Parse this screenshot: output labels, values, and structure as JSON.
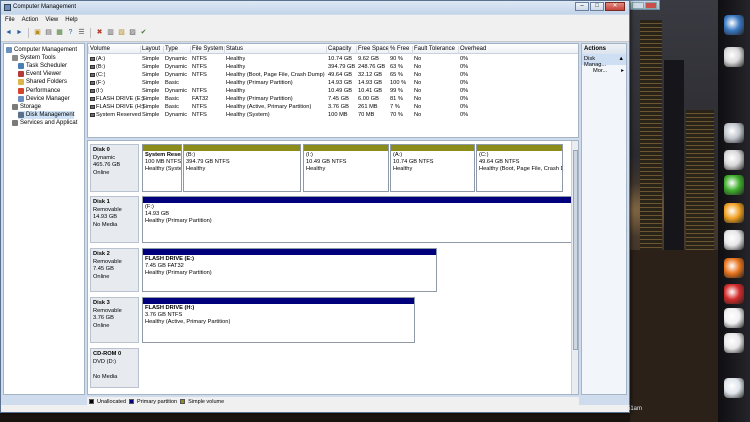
{
  "window": {
    "title": "Computer Management",
    "bg_window_title": ""
  },
  "menu": [
    "File",
    "Action",
    "View",
    "Help"
  ],
  "tree": [
    {
      "label": "Computer Management",
      "indent": 0,
      "icon": "computer-icon",
      "color": "#6b8fbf"
    },
    {
      "label": "System Tools",
      "indent": 1,
      "icon": "tools-icon",
      "color": "#8a8a8a"
    },
    {
      "label": "Task Scheduler",
      "indent": 2,
      "icon": "clock-icon",
      "color": "#4a7fb5"
    },
    {
      "label": "Event Viewer",
      "indent": 2,
      "icon": "event-icon",
      "color": "#b53a3a"
    },
    {
      "label": "Shared Folders",
      "indent": 2,
      "icon": "folder-icon",
      "color": "#d9b54a"
    },
    {
      "label": "Performance",
      "indent": 2,
      "icon": "performance-icon",
      "color": "#d4452d"
    },
    {
      "label": "Device Manager",
      "indent": 2,
      "icon": "device-icon",
      "color": "#6b8fbf"
    },
    {
      "label": "Storage",
      "indent": 1,
      "icon": "storage-icon",
      "color": "#7a7a7a"
    },
    {
      "label": "Disk Management",
      "indent": 2,
      "icon": "disk-icon",
      "color": "#5a6f8a"
    },
    {
      "label": "Services and Applicat",
      "indent": 1,
      "icon": "services-icon",
      "color": "#7a7a7a"
    }
  ],
  "volume_columns": [
    "Volume",
    "Layout",
    "Type",
    "File System",
    "Status",
    "Capacity",
    "Free Space",
    "% Free",
    "Fault Tolerance",
    "Overhead"
  ],
  "volumes": [
    [
      "(A:)",
      "Simple",
      "Dynamic",
      "NTFS",
      "Healthy",
      "10.74 GB",
      "9.62 GB",
      "90 %",
      "No",
      "0%"
    ],
    [
      "(B:)",
      "Simple",
      "Dynamic",
      "NTFS",
      "Healthy",
      "394.79 GB",
      "248.76 GB",
      "63 %",
      "No",
      "0%"
    ],
    [
      "(C:)",
      "Simple",
      "Dynamic",
      "NTFS",
      "Healthy (Boot, Page File, Crash Dump)",
      "49.64 GB",
      "32.12 GB",
      "65 %",
      "No",
      "0%"
    ],
    [
      "(F:)",
      "Simple",
      "Basic",
      "",
      "Healthy (Primary Partition)",
      "14.93 GB",
      "14.93 GB",
      "100 %",
      "No",
      "0%"
    ],
    [
      "(I:)",
      "Simple",
      "Dynamic",
      "NTFS",
      "Healthy",
      "10.49 GB",
      "10.41 GB",
      "99 %",
      "No",
      "0%"
    ],
    [
      "FLASH DRIVE (E:)",
      "Simple",
      "Basic",
      "FAT32",
      "Healthy (Primary Partition)",
      "7.45 GB",
      "6.00 GB",
      "81 %",
      "No",
      "0%"
    ],
    [
      "FLASH DRIVE (H:)",
      "Simple",
      "Basic",
      "NTFS",
      "Healthy (Active, Primary Partition)",
      "3.76 GB",
      "261 MB",
      "7 %",
      "No",
      "0%"
    ],
    [
      "System Reserved",
      "Simple",
      "Dynamic",
      "NTFS",
      "Healthy (System)",
      "100 MB",
      "70 MB",
      "70 %",
      "No",
      "0%"
    ]
  ],
  "disks": [
    {
      "name": "Disk 0",
      "type": "Dynamic",
      "size": "465.76 GB",
      "state": "Online",
      "partitions": [
        {
          "title": "System Reser",
          "size": "100 MB NTFS",
          "status": "Healthy (Syste",
          "bar": "olive",
          "bold": true
        },
        {
          "title": "(B:)",
          "size": "394.79 GB NTFS",
          "status": "Healthy",
          "bar": "olive",
          "bold": false
        },
        {
          "title": "(I:)",
          "size": "10.49 GB NTFS",
          "status": "Healthy",
          "bar": "olive",
          "bold": false
        },
        {
          "title": "(A:)",
          "size": "10.74 GB NTFS",
          "status": "Healthy",
          "bar": "olive",
          "bold": false
        },
        {
          "title": "(C:)",
          "size": "49.64 GB NTFS",
          "status": "Healthy (Boot, Page File, Crash Dump",
          "bar": "olive",
          "bold": false
        }
      ]
    },
    {
      "name": "Disk 1",
      "type": "Removable",
      "size": "14.93 GB",
      "state": "No Media",
      "partitions": [
        {
          "title": "(F:)",
          "size": "14.93 GB",
          "status": "Healthy (Primary Partition)",
          "bar": "navy",
          "bold": false
        }
      ]
    },
    {
      "name": "Disk 2",
      "type": "Removable",
      "size": "7.45 GB",
      "state": "Online",
      "partitions": [
        {
          "title": "FLASH DRIVE (E:)",
          "size": "7.45 GB FAT32",
          "status": "Healthy (Primary Partition)",
          "bar": "navy",
          "bold": true
        }
      ]
    },
    {
      "name": "Disk 3",
      "type": "Removable",
      "size": "3.76 GB",
      "state": "Online",
      "partitions": [
        {
          "title": "FLASH DRIVE (H:)",
          "size": "3.76 GB NTFS",
          "status": "Healthy (Active, Primary Partition)",
          "bar": "navy",
          "bold": true
        }
      ]
    },
    {
      "name": "CD-ROM 0",
      "type": "DVD (D:)",
      "size": "",
      "state": "No Media",
      "partitions": []
    }
  ],
  "legend": [
    {
      "label": "Unallocated",
      "color": "#000000"
    },
    {
      "label": "Primary partition",
      "color": "#00007c"
    },
    {
      "label": "Simple volume",
      "color": "#8c8c1a"
    }
  ],
  "actions": {
    "header": "Actions",
    "selected": "Disk Manag...",
    "more": "Mor..."
  },
  "clock": "51am",
  "dock_icons": [
    {
      "name": "globe-gadget-icon",
      "color": "#3a78c2"
    },
    {
      "name": "headset-icon",
      "color": "#d8d8d8"
    },
    {
      "name": "film-reel-icon",
      "color": "#c0c6cc"
    },
    {
      "name": "padlock-icon",
      "color": "#d8d8d8"
    },
    {
      "name": "green-cubes-icon",
      "color": "#3fae2c"
    },
    {
      "name": "xsplit-icon",
      "color": "#f0a020"
    },
    {
      "name": "opera-o-icon",
      "color": "#e6e6e6"
    },
    {
      "name": "firefox-icon",
      "color": "#e8731c"
    },
    {
      "name": "opera-red-icon",
      "color": "#d42a2a"
    },
    {
      "name": "black-logo-icon",
      "color": "#f0f0f0"
    },
    {
      "name": "alien-head-icon",
      "color": "#e8e8e8"
    },
    {
      "name": "drive-icon",
      "color": "#dfe5ea"
    }
  ]
}
